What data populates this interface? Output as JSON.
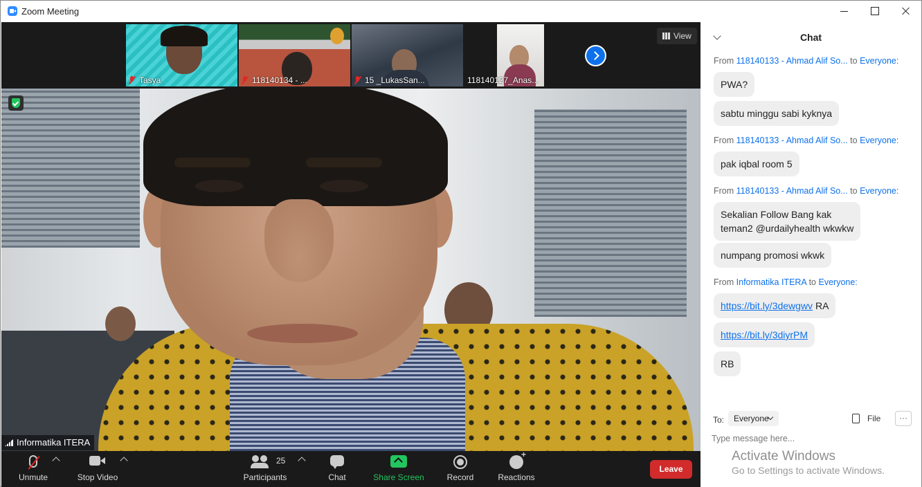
{
  "window": {
    "title": "Zoom Meeting"
  },
  "thumbnails": [
    {
      "name": "Tasya",
      "muted": true
    },
    {
      "name": "118140134 - ...",
      "muted": true
    },
    {
      "name": "15 _LukasSan...",
      "muted": true
    },
    {
      "name": "118140127_Anas...",
      "muted": false
    }
  ],
  "view_button": {
    "label": "View"
  },
  "speaker": {
    "name": "Informatika ITERA"
  },
  "toolbar": {
    "unmute_label": "Unmute",
    "stop_video_label": "Stop Video",
    "participants_label": "Participants",
    "participants_count": "25",
    "chat_label": "Chat",
    "share_label": "Share Screen",
    "record_label": "Record",
    "reactions_label": "Reactions",
    "leave_label": "Leave"
  },
  "chat": {
    "title": "Chat",
    "messages": [
      {
        "from_prefix": "From",
        "sender": "118140133 - Ahmad Alif So...",
        "to_word": "to",
        "recipient": "Everyone:",
        "lines": [
          "PWA?",
          "sabtu minggu sabi kyknya"
        ]
      },
      {
        "from_prefix": "From",
        "sender": "118140133 - Ahmad Alif So...",
        "to_word": "to",
        "recipient": "Everyone:",
        "lines": [
          "pak iqbal room 5"
        ]
      },
      {
        "from_prefix": "From",
        "sender": "118140133 - Ahmad Alif So...",
        "to_word": "to",
        "recipient": "Everyone:",
        "lines": [
          "Sekalian Follow Bang kak",
          "teman2 @urdailyhealth wkwkw",
          "numpang promosi wkwk"
        ]
      },
      {
        "from_prefix": "From",
        "sender": "Informatika ITERA",
        "to_word": "to",
        "recipient": "Everyone:",
        "links": [
          {
            "url": "https://bit.ly/3dewgwv",
            "suffix": " RA"
          },
          {
            "url": "https://bit.ly/3diyrPM",
            "suffix": ""
          }
        ],
        "lines": [
          "RB"
        ]
      }
    ],
    "to_label": "To:",
    "to_value": "Everyone",
    "file_label": "File",
    "more_label": "···",
    "input_placeholder": "Type message here..."
  },
  "watermark": {
    "title": "Activate Windows",
    "subtitle": "Go to Settings to activate Windows."
  },
  "colors": {
    "accent": "#0e71eb",
    "leave": "#d22b2b",
    "share": "#23c55e",
    "muted": "#e02828"
  }
}
